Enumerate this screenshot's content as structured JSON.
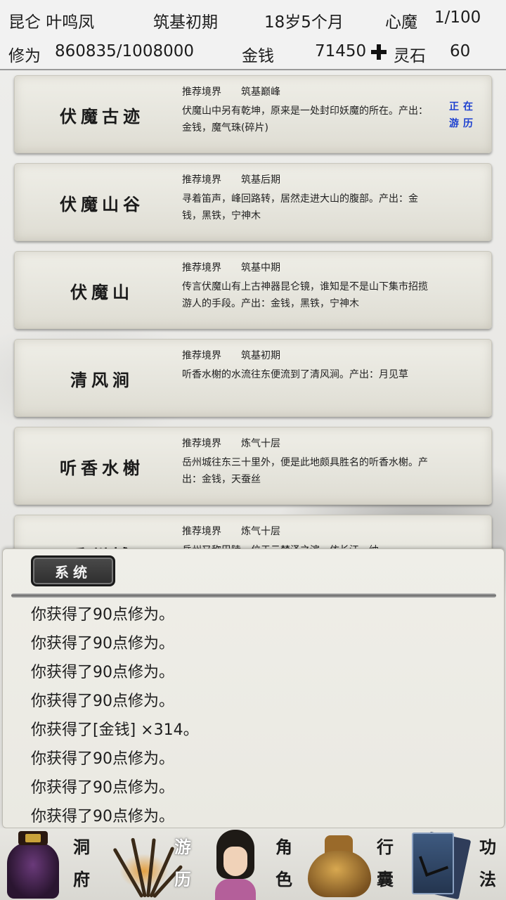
{
  "header": {
    "player_name": "昆仑 叶鸣凤",
    "realm": "筑基初期",
    "age": "18岁5个月",
    "demon_label": "心魔",
    "demon_value": "1/100",
    "cultivation_label": "修为",
    "cultivation_value": "860835/1008000",
    "money_label": "金钱",
    "money_value": "71450",
    "add_icon": "plus-icon",
    "spirit_stone_label": "灵石",
    "spirit_stone_value": "60"
  },
  "locations": [
    {
      "name": "伏魔古迹",
      "rec_label": "推荐境界",
      "rec_realm": "筑基巅峰",
      "desc": "伏魔山中另有乾坤，原来是一处封印妖魔的所在。产出：金钱，魔气珠(碎片)",
      "status": "正在游历"
    },
    {
      "name": "伏魔山谷",
      "rec_label": "推荐境界",
      "rec_realm": "筑基后期",
      "desc": "寻着笛声，峰回路转，居然走进大山的腹部。产出：金钱，黑铁，宁神木"
    },
    {
      "name": "伏魔山",
      "rec_label": "推荐境界",
      "rec_realm": "筑基中期",
      "desc": "传言伏魔山有上古神器昆仑镜，谁知是不是山下集市招揽游人的手段。产出：金钱，黑铁，宁神木"
    },
    {
      "name": "清风涧",
      "rec_label": "推荐境界",
      "rec_realm": "筑基初期",
      "desc": "听香水榭的水流往东便流到了清风涧。产出：月见草"
    },
    {
      "name": "听香水榭",
      "rec_label": "推荐境界",
      "rec_realm": "炼气十层",
      "desc": "岳州城往东三十里外，便是此地颇具胜名的听香水榭。产出：金钱，天蚕丝"
    },
    {
      "name": "岳州城",
      "rec_label": "推荐境界",
      "rec_realm": "炼气十层",
      "desc": "岳州又称巴陵，位于云梦泽之滨，依长江，纳"
    }
  ],
  "log": {
    "tab_label": "系统",
    "lines": [
      "你获得了90点修为。",
      "你获得了90点修为。",
      "你获得了90点修为。",
      "你获得了90点修为。",
      "你获得了[金钱] ×314。",
      "你获得了90点修为。",
      "你获得了90点修为。",
      "你获得了90点修为。"
    ]
  },
  "nav": {
    "cave": {
      "c1": "洞",
      "c2": "府",
      "icon": "cave-dwelling-icon"
    },
    "travel": {
      "c1": "游",
      "c2": "历",
      "icon": "travel-icon"
    },
    "character": {
      "c1": "角",
      "c2": "色",
      "icon": "character-portrait-icon"
    },
    "bag": {
      "c1": "行",
      "c2": "囊",
      "icon": "bag-icon"
    },
    "skills": {
      "c1": "功",
      "c2": "法",
      "icon": "book-icon"
    }
  }
}
